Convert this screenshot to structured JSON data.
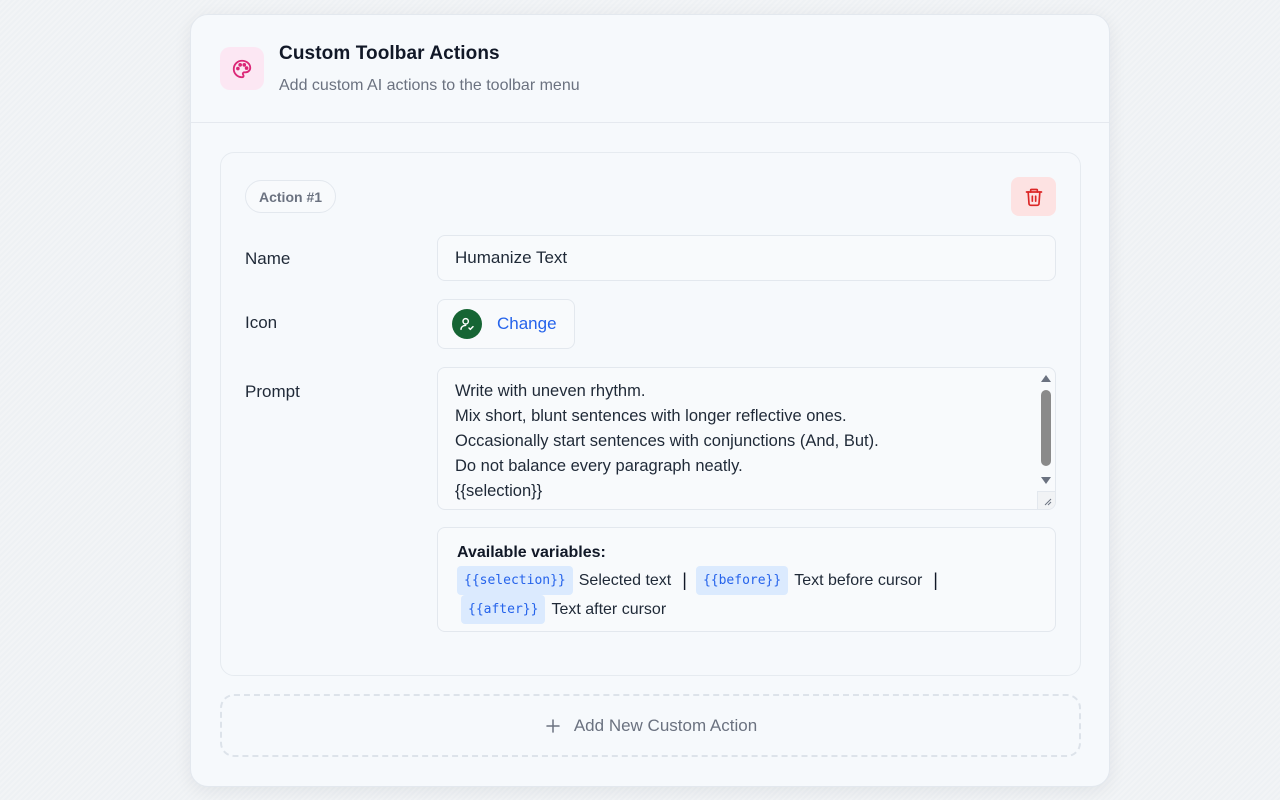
{
  "header": {
    "title": "Custom Toolbar Actions",
    "subtitle": "Add custom AI actions to the toolbar menu",
    "icon": "palette-icon",
    "icon_bg": "#fce7f3",
    "icon_color": "#db2777"
  },
  "action": {
    "badge": "Action #1",
    "delete_icon": "trash-icon",
    "name_label": "Name",
    "name_value": "Humanize Text",
    "icon_label": "Icon",
    "icon_name": "user-check-icon",
    "icon_color": "#166534",
    "change_label": "Change",
    "prompt_label": "Prompt",
    "prompt_value": "Write with uneven rhythm.\nMix short, blunt sentences with longer reflective ones.\nOccasionally start sentences with conjunctions (And, But).\nDo not balance every paragraph neatly.\n{{selection}}",
    "variables": {
      "title": "Available variables:",
      "items": [
        {
          "code": "{{selection}}",
          "desc": "Selected text"
        },
        {
          "code": "{{before}}",
          "desc": "Text before cursor"
        },
        {
          "code": "{{after}}",
          "desc": "Text after cursor"
        }
      ],
      "separator": "|"
    }
  },
  "add_action": {
    "label": "Add New Custom Action",
    "icon": "plus-icon"
  },
  "colors": {
    "accent": "#2563eb",
    "danger": "#dc2626",
    "danger_bg": "#fde2e2"
  }
}
